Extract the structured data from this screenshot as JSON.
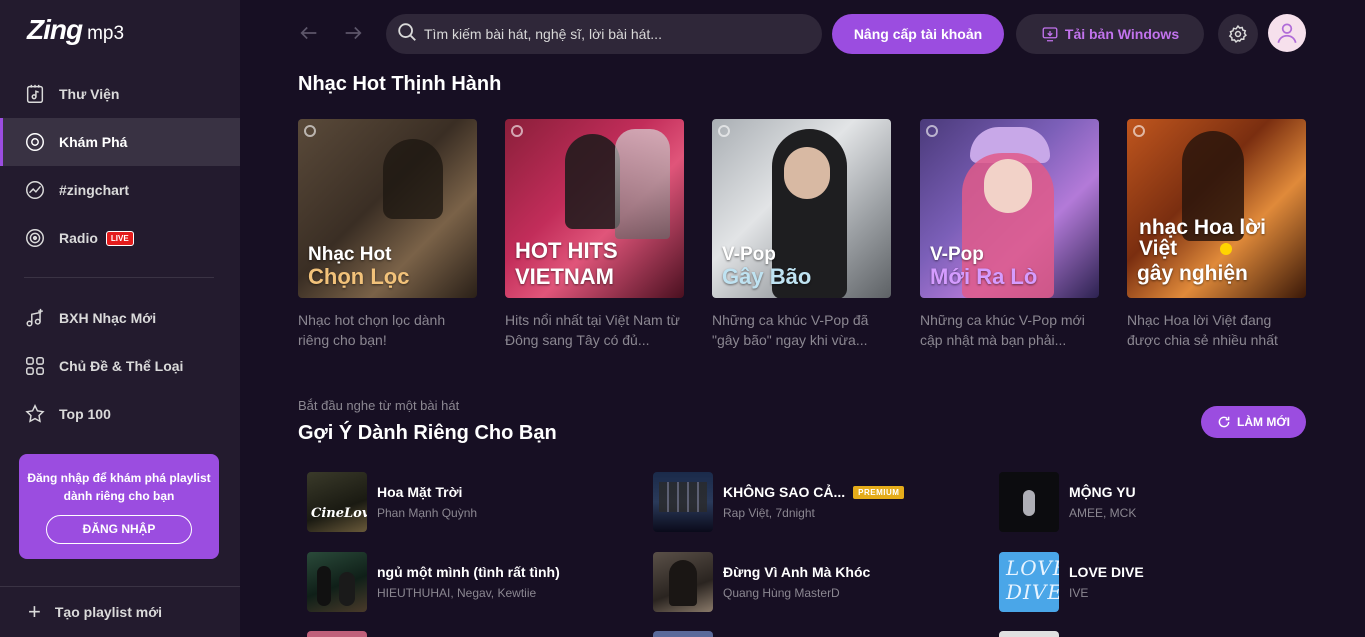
{
  "logo": {
    "brand": "Zing",
    "suffix": "mp3"
  },
  "nav": {
    "items": [
      {
        "label": "Thư Viện",
        "icon": "library-icon"
      },
      {
        "label": "Khám Phá",
        "icon": "disc-icon"
      },
      {
        "label": "#zingchart",
        "icon": "chart-icon"
      },
      {
        "label": "Radio",
        "icon": "radio-icon",
        "badge": "LIVE"
      },
      {
        "label": "BXH Nhạc Mới",
        "icon": "music-star-icon"
      },
      {
        "label": "Chủ Đề & Thể Loại",
        "icon": "category-icon"
      },
      {
        "label": "Top 100",
        "icon": "star-icon"
      }
    ],
    "active": "Khám Phá"
  },
  "login_box": {
    "text": "Đăng nhập để khám phá playlist dành riêng cho bạn",
    "button": "ĐĂNG NHẬP"
  },
  "sidebar_bottom": {
    "label": "Tạo playlist mới"
  },
  "header": {
    "search_placeholder": "Tìm kiếm bài hát, nghệ sĩ, lời bài hát...",
    "upgrade_label": "Nâng cấp tài khoản",
    "download_label": "Tải bản Windows"
  },
  "hot": {
    "title": "Nhạc Hot Thịnh Hành",
    "cards": [
      {
        "cover1": "Nhạc Hot",
        "cover2": "Chọn Lọc",
        "desc": "Nhạc hot chọn lọc dành riêng cho bạn!",
        "accent": "#f2c27a"
      },
      {
        "cover1": "HOT HITS",
        "cover2": "VIETNAM",
        "desc": "Hits nổi nhất tại Việt Nam từ Đông sang Tây có đủ...",
        "accent": "#ffffff"
      },
      {
        "cover1": "V-Pop",
        "cover2": "Gây Bão",
        "desc": "Những ca khúc V-Pop đã \"gây bão\" ngay khi vừa...",
        "accent": "#bfe3f2"
      },
      {
        "cover1": "V-Pop",
        "cover2": "Mới Ra Lò",
        "desc": "Những ca khúc V-Pop mới cập nhật mà bạn phải...",
        "accent": "#d59cff"
      },
      {
        "cover1": "nhạc Hoa lời Việt",
        "cover2": "gây nghiện",
        "desc": "Nhạc Hoa lời Việt đang được chia sẻ nhiều nhất",
        "accent": "#ffffff"
      }
    ]
  },
  "suggest": {
    "subtitle": "Bắt đầu nghe từ một bài hát",
    "title": "Gợi Ý Dành Riêng Cho Bạn",
    "refresh_label": "LÀM MỚI",
    "songs": [
      {
        "title": "Hoa Mặt Trời",
        "artist": "Phan Mạnh Quỳnh"
      },
      {
        "title": "KHÔNG SAO CẢ...",
        "artist": "Rap Việt, 7dnight",
        "badge": "PREMIUM"
      },
      {
        "title": "MỘNG YU",
        "artist": "AMEE, MCK"
      },
      {
        "title": "ngủ một mình (tình rất tình)",
        "artist": "HIEUTHUHAI, Negav, Kewtiie"
      },
      {
        "title": "Đừng Vì Anh Mà Khóc",
        "artist": "Quang Hùng MasterD"
      },
      {
        "title": "LOVE DIVE",
        "artist": "IVE"
      }
    ]
  },
  "colors": {
    "accent": "#9b4de0",
    "sidebar": "#231b2e",
    "background": "#170f23",
    "live": "#e41c1c",
    "premium": "#e5ac1a"
  }
}
